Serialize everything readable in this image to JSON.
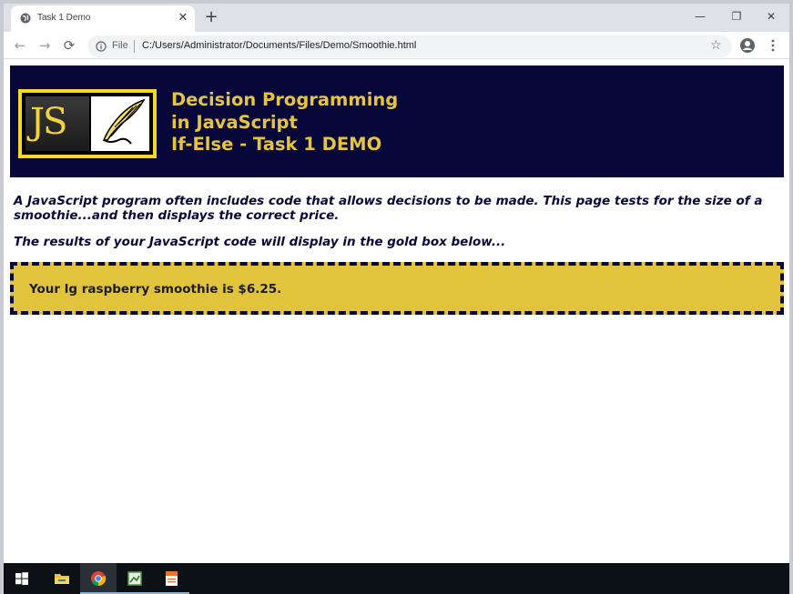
{
  "browser": {
    "tab_title": "Task 1 Demo",
    "new_tab_symbol": "+",
    "close_symbol": "✕",
    "window_controls": {
      "minimize": "—",
      "restore": "❐",
      "close": "✕"
    },
    "nav": {
      "back": "←",
      "forward": "→",
      "reload": "⟳"
    },
    "scheme_label": "File",
    "url": "C:/Users/Administrator/Documents/Files/Demo/Smoothie.html",
    "bookmark_symbol": "☆"
  },
  "page": {
    "logo_text": "JS",
    "banner_lines": [
      "Decision Programming",
      "in JavaScript",
      "If-Else - Task 1 DEMO"
    ],
    "intro": "A JavaScript program often includes code that allows decisions to be made. This page tests for the size of a smoothie...and then displays the correct price.",
    "results_note": "The results of your JavaScript code will display in the gold box below...",
    "result": "Your lg raspberry smoothie is $6.25."
  },
  "colors": {
    "banner_bg": "#07073a",
    "banner_text": "#e6c43b",
    "logo_border": "#f7d91d",
    "result_bg": "#e2c43c"
  },
  "taskbar": {
    "items": [
      "windows-start-icon",
      "file-explorer-icon",
      "chrome-icon",
      "image-editor-icon",
      "document-app-icon"
    ]
  }
}
